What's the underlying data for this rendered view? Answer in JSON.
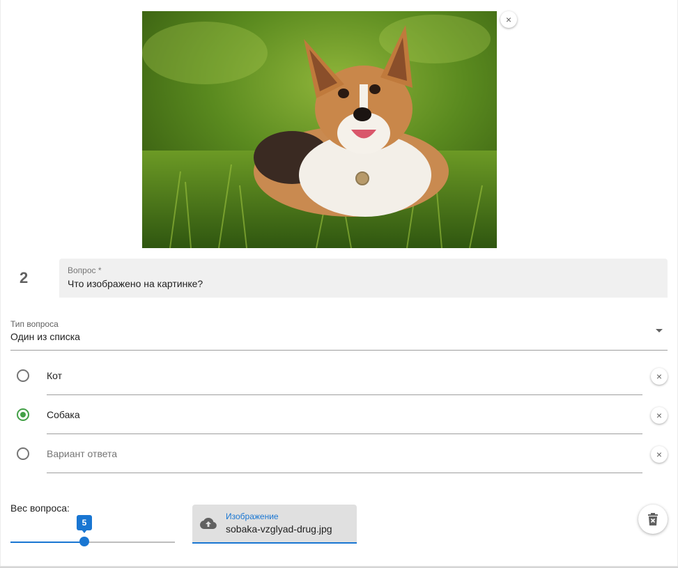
{
  "image": {
    "remove_symbol": "×",
    "subject": "dog-photo"
  },
  "question": {
    "number": "2",
    "label": "Вопрос *",
    "value": "Что изображено на картинке?"
  },
  "question_type": {
    "label": "Тип вопроса",
    "value": "Один из списка"
  },
  "options": [
    {
      "text": "Кот",
      "selected": false,
      "placeholder": false,
      "remove_symbol": "×"
    },
    {
      "text": "Собака",
      "selected": true,
      "placeholder": false,
      "remove_symbol": "×"
    },
    {
      "text": "Вариант ответа",
      "selected": false,
      "placeholder": true,
      "remove_symbol": "×"
    }
  ],
  "weight": {
    "label": "Вес вопроса:",
    "value": "5",
    "level": 0.45
  },
  "image_field": {
    "label": "Изображение",
    "value": "sobaka-vzglyad-drug.jpg",
    "icon": "cloud-upload-icon"
  },
  "delete_question": {
    "icon": "delete-forever-icon"
  },
  "colors": {
    "accent": "#1976d2",
    "radio_selected": "#43a047",
    "field_bg": "#f0f0f0"
  }
}
